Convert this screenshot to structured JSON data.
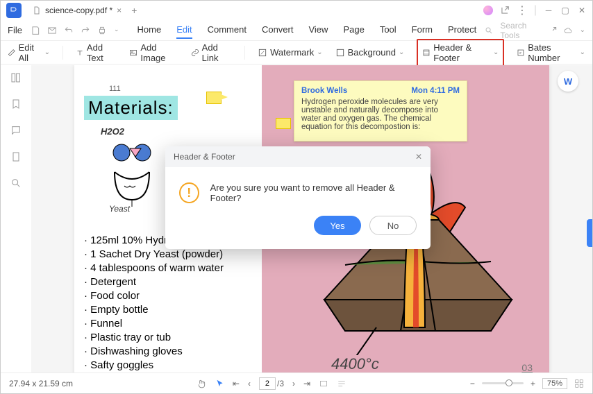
{
  "titlebar": {
    "tab_name": "science-copy.pdf *"
  },
  "menu": {
    "file": "File",
    "items": [
      "Home",
      "Edit",
      "Comment",
      "Convert",
      "View",
      "Page",
      "Tool",
      "Form",
      "Protect"
    ],
    "active_index": 1,
    "search_placeholder": "Search Tools"
  },
  "toolbar": {
    "edit_all": "Edit All",
    "add_text": "Add Text",
    "add_image": "Add Image",
    "add_link": "Add Link",
    "watermark": "Watermark",
    "background": "Background",
    "header_footer": "Header & Footer",
    "bates": "Bates Number"
  },
  "document": {
    "top_page_num": "111",
    "materials_title": "Materials:",
    "h2o2_label": "H2O2",
    "yeast_label": "Yeast",
    "ingredients": [
      "125ml 10% Hydrogen Peroxide",
      "1 Sachet Dry Yeast (powder)",
      "4 tablespoons of warm water",
      "Detergent",
      "Food color",
      "Empty bottle",
      "Funnel",
      "Plastic tray or tub",
      "Dishwashing gloves",
      "Safty goggles"
    ],
    "temperature": "4400°c",
    "bottom_page_num": "03"
  },
  "comment": {
    "author": "Brook Wells",
    "time": "Mon 4:11 PM",
    "body": "Hydrogen peroxide molecules are very unstable and naturally decompose into water and oxygen gas. The chemical equation for this decompostion is:"
  },
  "dialog": {
    "title": "Header & Footer",
    "message": "Are you sure you want to remove all Header & Footer?",
    "yes": "Yes",
    "no": "No"
  },
  "statusbar": {
    "dims": "27.94 x 21.59 cm",
    "current_page": "2",
    "total_pages": "/3",
    "zoom": "75%"
  }
}
